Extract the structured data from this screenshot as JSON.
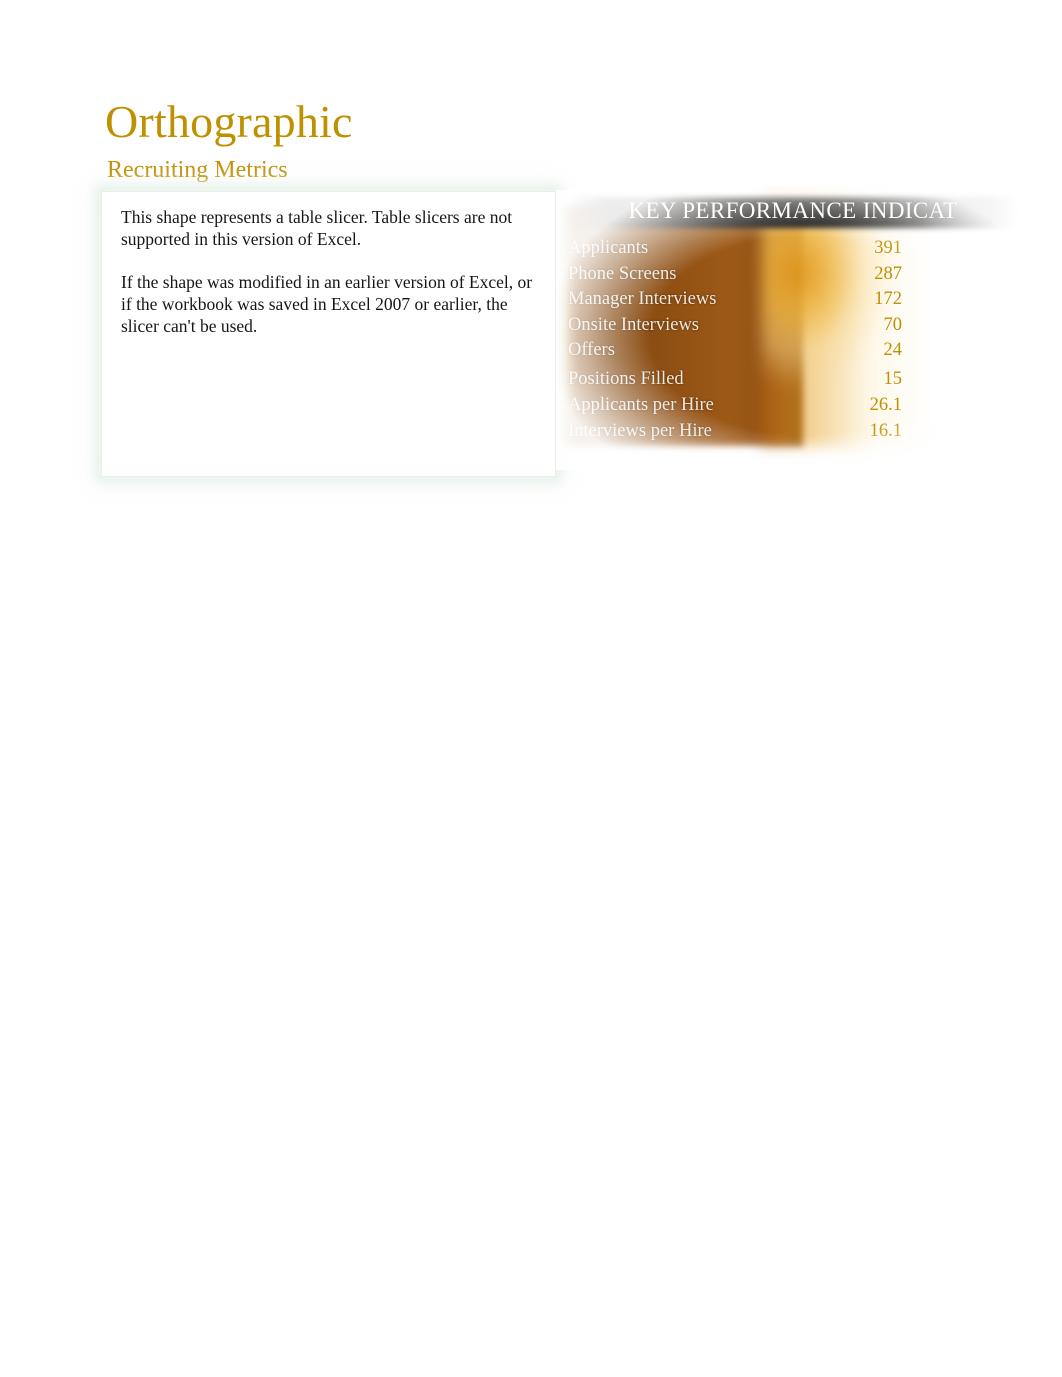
{
  "page": {
    "title": "Orthographic",
    "subtitle": "Recruiting Metrics",
    "background_color": "#ffffff",
    "accent_color": "#bf9000"
  },
  "slicer_placeholder": {
    "paragraph_1": "This shape represents a table slicer. Table slicers are not supported in this version of Excel.",
    "paragraph_2": "If the shape was modified in an earlier version of Excel, or if the workbook was saved in Excel 2007 or earlier, the slicer can't be used."
  },
  "kpi_panel": {
    "header": "KEY PERFORMANCE INDICAT",
    "header_text_color": "#ffffff",
    "label_color": "#f3e9dd",
    "value_color": "#bf8f00",
    "plate_color": "#8a4a10",
    "rows": [
      {
        "label": "Applicants",
        "value": "391",
        "group_break": false
      },
      {
        "label": "Phone Screens",
        "value": "287",
        "group_break": false
      },
      {
        "label": "Manager Interviews",
        "value": "172",
        "group_break": false
      },
      {
        "label": "Onsite Interviews",
        "value": "70",
        "group_break": false
      },
      {
        "label": "Offers",
        "value": "24",
        "group_break": false
      },
      {
        "label": "Positions Filled",
        "value": "15",
        "group_break": true
      },
      {
        "label": "Applicants per Hire",
        "value": "26.1",
        "group_break": false
      },
      {
        "label": "Interviews per Hire",
        "value": "16.1",
        "group_break": false
      }
    ]
  }
}
